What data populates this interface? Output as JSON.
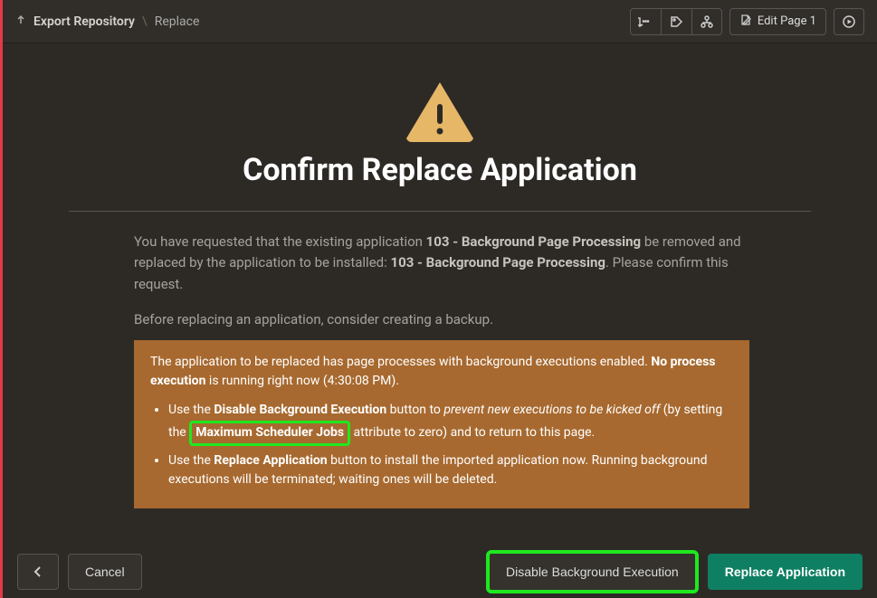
{
  "breadcrumb": {
    "parent": "Export Repository",
    "current": "Replace"
  },
  "toolbar": {
    "edit_page_label": "Edit Page 1"
  },
  "heading": "Confirm Replace Application",
  "description": {
    "pre": "You have requested that the existing application ",
    "app_existing": "103 - Background Page Processing",
    "mid": " be removed and replaced by the application to be installed: ",
    "app_new": "103 - Background Page Processing",
    "post": ". Please confirm this request."
  },
  "backup_hint": "Before replacing an application, consider creating a backup.",
  "alert": {
    "intro_pre": "The application to be replaced has page processes with background executions enabled. ",
    "no_process": "No process execution",
    "intro_post": " is running right now (4:30:08 PM).",
    "bullet1": {
      "pre": "Use the ",
      "disable_bold": "Disable Background Execution",
      "mid1": " button to ",
      "prevent_italic": "prevent new executions to be kicked off",
      "mid2": " (by setting the ",
      "max_jobs": "Maximum Scheduler Jobs",
      "post": " attribute to zero) and to return to this page."
    },
    "bullet2": {
      "pre": "Use the ",
      "replace_bold": "Replace Application",
      "post": " button to install the imported application now. Running background executions will be terminated; waiting ones will be deleted."
    }
  },
  "buttons": {
    "cancel": "Cancel",
    "disable": "Disable Background Execution",
    "replace": "Replace Application"
  }
}
